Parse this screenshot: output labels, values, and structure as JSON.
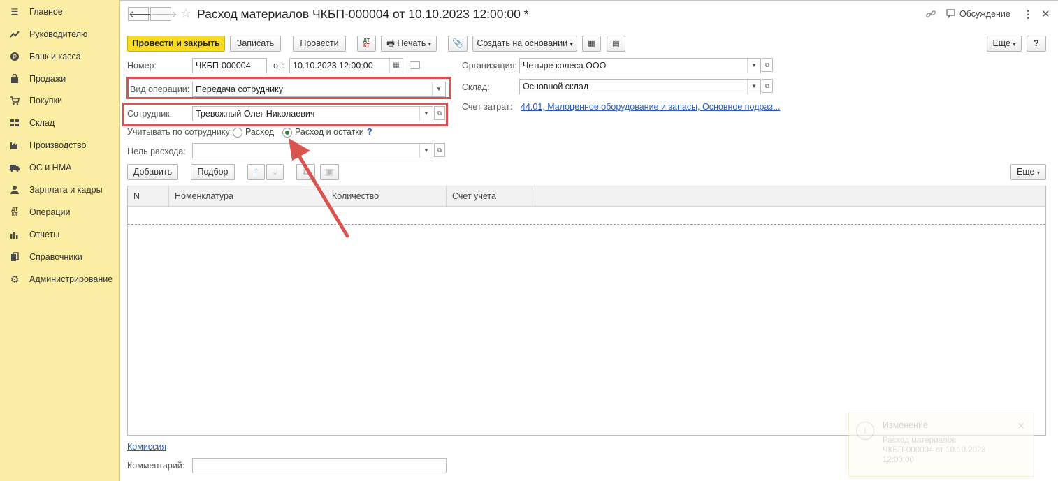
{
  "sidebar": {
    "items": [
      {
        "icon": "menu-icon",
        "label": "Главное"
      },
      {
        "icon": "trend-icon",
        "label": "Руководителю"
      },
      {
        "icon": "coin-icon",
        "label": "Банк и касса"
      },
      {
        "icon": "bag-icon",
        "label": "Продажи"
      },
      {
        "icon": "cart-icon",
        "label": "Покупки"
      },
      {
        "icon": "warehouse-icon",
        "label": "Склад"
      },
      {
        "icon": "factory-icon",
        "label": "Производство"
      },
      {
        "icon": "truck-icon",
        "label": "ОС и НМА"
      },
      {
        "icon": "person-icon",
        "label": "Зарплата и кадры"
      },
      {
        "icon": "dt-kt-icon",
        "label": "Операции"
      },
      {
        "icon": "bar-chart-icon",
        "label": "Отчеты"
      },
      {
        "icon": "books-icon",
        "label": "Справочники"
      },
      {
        "icon": "gear-icon",
        "label": "Администрирование"
      }
    ]
  },
  "header": {
    "title": "Расход материалов ЧКБП-000004 от 10.10.2023 12:00:00 *",
    "discussion": "Обсуждение"
  },
  "toolbar": {
    "post_close": "Провести и закрыть",
    "save": "Записать",
    "post": "Провести",
    "dtkt": "ДТ КТ",
    "print": "Печать",
    "create_based": "Создать на основании",
    "more": "Еще",
    "help": "?"
  },
  "form": {
    "number_label": "Номер:",
    "number_value": "ЧКБП-000004",
    "date_label": "от:",
    "date_value": "10.10.2023 12:00:00",
    "op_type_label": "Вид операции:",
    "op_type_value": "Передача сотруднику",
    "employee_label": "Сотрудник:",
    "employee_value": "Тревожный Олег Николаевич",
    "account_by_label": "Учитывать по сотруднику:",
    "radio_expense": "Расход",
    "radio_expense_balance": "Расход и остатки",
    "radio_selected": "Расход и остатки",
    "help_mark": "?",
    "purpose_label": "Цель расхода:",
    "purpose_value": "",
    "org_label": "Организация:",
    "org_value": "Четыре колеса ООО",
    "warehouse_label": "Склад:",
    "warehouse_value": "Основной склад",
    "cost_account_label": "Счет затрат:",
    "cost_account_value": "44.01, Малоценное оборудование и запасы, Основное подраз..."
  },
  "table_toolbar": {
    "add": "Добавить",
    "pick": "Подбор",
    "more": "Еще"
  },
  "table": {
    "columns": [
      "N",
      "Номенклатура",
      "Количество",
      "Счет учета"
    ],
    "rows": []
  },
  "footer": {
    "commission_link": "Комиссия",
    "comment_label": "Комментарий:",
    "comment_value": ""
  },
  "notification": {
    "title": "Изменение",
    "body": "Расход материалов ЧКБП-000004 от 10.10.2023 12:00:00"
  },
  "colors": {
    "sidebar_bg": "#fbeda4",
    "primary_button": "#f9da25",
    "highlight_red": "#d9534f",
    "link_blue": "#2a5fb7"
  }
}
